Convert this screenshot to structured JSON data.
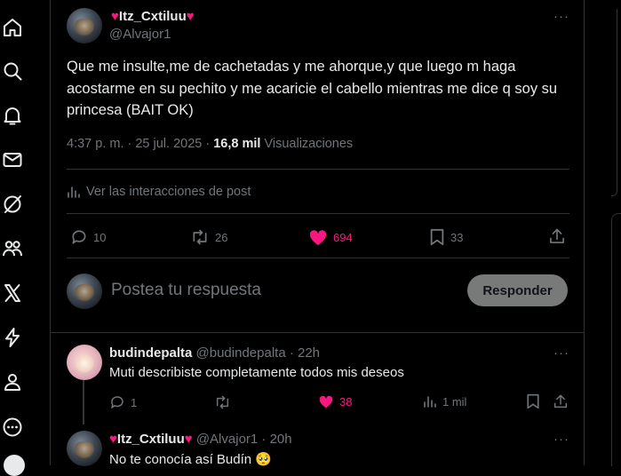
{
  "nav": {
    "items": [
      "home-icon",
      "search-icon",
      "notifications-icon",
      "messages-icon",
      "grok-icon",
      "communities-icon",
      "x-premium-icon",
      "verified-orgs-icon",
      "profile-icon",
      "more-icon"
    ]
  },
  "post": {
    "display_name": "Itz_Cxtiluu",
    "heart_emoji": "♥",
    "handle": "@Alvajor1",
    "text": "Que me insulte,me de cachetadas y me ahorque,y que luego m haga acostarme en su pechito y me acaricie el cabello mientras me dice q soy su princesa (BAIT OK)",
    "time": "4:37 p. m. · 25 jul. 2025 ·",
    "views_count": "16,8 mil",
    "views_label": "Visualizaciones",
    "interactions_link": "Ver las interacciones de post",
    "replies": "10",
    "reposts": "26",
    "likes": "694",
    "bookmarks": "33",
    "more": "···"
  },
  "composer": {
    "placeholder": "Postea tu respuesta",
    "button": "Responder"
  },
  "replies": [
    {
      "display_name": "budindepalta",
      "handle": "@budindepalta · 22h",
      "text": "Muti describiste completamente todos mis deseos",
      "replies": "1",
      "reposts": "",
      "likes": "38",
      "views": "1 mil",
      "more": "···"
    },
    {
      "display_name": "Itz_Cxtiluu",
      "heart_emoji": "♥",
      "handle": "@Alvajor1 · 20h",
      "text": "No te conocía así Budín",
      "emoji": "🥺",
      "more": "···"
    }
  ],
  "colors": {
    "background": "#000000",
    "text": "#e7e9ea",
    "muted": "#71767b",
    "like_pink": "#f91880",
    "divider": "#2f3336"
  }
}
